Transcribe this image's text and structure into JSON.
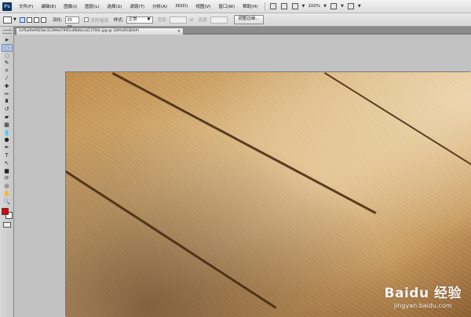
{
  "app": {
    "logo": "Ps"
  },
  "menubar": {
    "items": [
      "文件(F)",
      "编辑(E)",
      "图像(I)",
      "图层(L)",
      "选择(S)",
      "滤镜(T)",
      "分析(A)",
      "3D(D)",
      "视图(V)",
      "窗口(W)",
      "帮助(H)"
    ],
    "zoom": "100%"
  },
  "options": {
    "feather_label": "羽化:",
    "feather_value": "25 px",
    "antialias_label": "消除锯齿",
    "style_label": "样式:",
    "style_value": "正常",
    "width_label": "宽度:",
    "height_label": "高度:",
    "refine_button": "调整边缘..."
  },
  "document": {
    "tab_title": "2cf5a0fe9925bc3139fe07995cdf8db1cb13700c.jpg @ 100%(RGB/8#)",
    "close": "×"
  },
  "watermark": {
    "logo_text": "Baidu 经验",
    "url": "jingyan.baidu.com"
  },
  "colors": {
    "foreground": "#e00000",
    "background": "#ffffff"
  }
}
